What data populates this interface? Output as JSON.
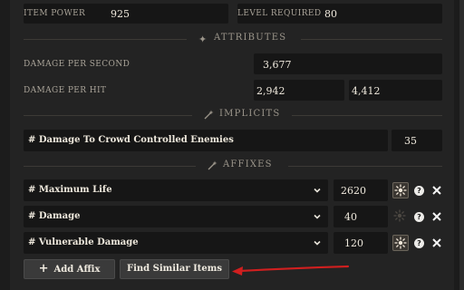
{
  "top": {
    "item_power_label": "ITEM POWER",
    "item_power_value": "925",
    "level_required_label": "LEVEL REQUIRED",
    "level_required_value": "80"
  },
  "attributes": {
    "section_title": "ATTRIBUTES",
    "dps_label": "DAMAGE PER SECOND",
    "dps_value": "3,677",
    "dph_label": "DAMAGE PER HIT",
    "dph_min": "2,942",
    "dph_max": "4,412"
  },
  "implicits": {
    "section_title": "IMPLICITS",
    "rows": [
      {
        "name": "# Damage To Crowd Controlled Enemies",
        "value": "35"
      }
    ]
  },
  "affixes": {
    "section_title": "AFFIXES",
    "rows": [
      {
        "name": "# Maximum Life",
        "value": "2620",
        "greater": true
      },
      {
        "name": "# Damage",
        "value": "40",
        "greater": false
      },
      {
        "name": "# Vulnerable Damage",
        "value": "120",
        "greater": true
      }
    ]
  },
  "buttons": {
    "add_affix": "Add Affix",
    "add_icon": "+",
    "find_similar": "Find Similar Items"
  },
  "icons": {
    "help_glyph": "?",
    "attributes_icon": "sparkle-icon",
    "implicits_icon": "wand-icon",
    "affixes_icon": "wand-icon"
  },
  "colors": {
    "annotation_arrow": "#d11f1f",
    "background": "#232323",
    "input_bg": "#161616"
  }
}
